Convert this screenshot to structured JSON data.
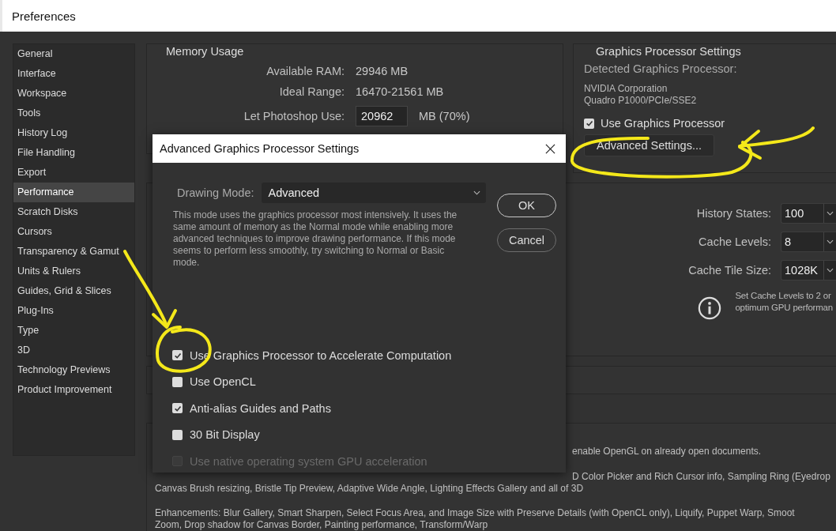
{
  "window": {
    "title": "Preferences"
  },
  "sidebar": {
    "items": [
      {
        "label": "General",
        "selected": false
      },
      {
        "label": "Interface",
        "selected": false
      },
      {
        "label": "Workspace",
        "selected": false
      },
      {
        "label": "Tools",
        "selected": false
      },
      {
        "label": "History Log",
        "selected": false
      },
      {
        "label": "File Handling",
        "selected": false
      },
      {
        "label": "Export",
        "selected": false
      },
      {
        "label": "Performance",
        "selected": true
      },
      {
        "label": "Scratch Disks",
        "selected": false
      },
      {
        "label": "Cursors",
        "selected": false
      },
      {
        "label": "Transparency & Gamut",
        "selected": false
      },
      {
        "label": "Units & Rulers",
        "selected": false
      },
      {
        "label": "Guides, Grid & Slices",
        "selected": false
      },
      {
        "label": "Plug-Ins",
        "selected": false
      },
      {
        "label": "Type",
        "selected": false
      },
      {
        "label": "3D",
        "selected": false
      },
      {
        "label": "Technology Previews",
        "selected": false
      },
      {
        "label": "Product Improvement",
        "selected": false
      }
    ]
  },
  "memory_usage": {
    "title": "Memory Usage",
    "rows": [
      {
        "label": "Available RAM:",
        "value": "29946 MB"
      },
      {
        "label": "Ideal Range:",
        "value": "16470-21561 MB"
      }
    ],
    "let_photoshop_use": {
      "label": "Let Photoshop Use:",
      "value": "20962",
      "unit": "MB (70%)"
    }
  },
  "graphics_processor": {
    "title": "Graphics Processor Settings",
    "detected_label": "Detected Graphics Processor:",
    "gpu_lines": [
      "NVIDIA Corporation",
      "Quadro P1000/PCIe/SSE2"
    ],
    "use_gpu": {
      "label": "Use Graphics Processor",
      "checked": true
    },
    "advanced_button": "Advanced Settings..."
  },
  "history_cache": {
    "fields": [
      {
        "label": "History States:",
        "value": "100"
      },
      {
        "label": "Cache Levels:",
        "value": "8"
      },
      {
        "label": "Cache Tile Size:",
        "value": "1028K"
      }
    ],
    "info_lines": [
      "Set Cache Levels to 2 or",
      "optimum GPU performan"
    ]
  },
  "gpu_notes": {
    "partial_lines": [
      "enable OpenGL on already open documents.",
      "D Color Picker and Rich Cursor info, Sampling Ring (Eyedrop"
    ],
    "lines": [
      "Canvas Brush resizing, Bristle Tip Preview, Adaptive Wide Angle, Lighting Effects Gallery and all of 3D",
      "Enhancements: Blur Gallery, Smart Sharpen, Select Focus Area, and Image Size with Preserve Details (with OpenCL only), Liquify, Puppet Warp, Smoot",
      "Zoom, Drop shadow for Canvas Border, Painting performance, Transform/Warp"
    ]
  },
  "dialog": {
    "title": "Advanced Graphics Processor Settings",
    "drawing_mode": {
      "label": "Drawing Mode:",
      "value": "Advanced"
    },
    "description": "This mode uses the graphics processor most intensively.  It uses the same amount of memory as the Normal mode while enabling more advanced techniques to improve drawing performance.  If this mode seems to perform less smoothly, try switching to Normal or Basic mode.",
    "buttons": [
      {
        "label": "OK",
        "default": true
      },
      {
        "label": "Cancel",
        "default": false
      }
    ],
    "options": [
      {
        "label": "Use Graphics Processor to Accelerate Computation",
        "checked": true,
        "disabled": false
      },
      {
        "label": "Use OpenCL",
        "checked": false,
        "disabled": false
      },
      {
        "label": "Anti-alias Guides and Paths",
        "checked": true,
        "disabled": false
      },
      {
        "label": "30 Bit Display",
        "checked": false,
        "disabled": false
      },
      {
        "label": "Use native operating system GPU acceleration",
        "checked": false,
        "disabled": true
      }
    ]
  }
}
